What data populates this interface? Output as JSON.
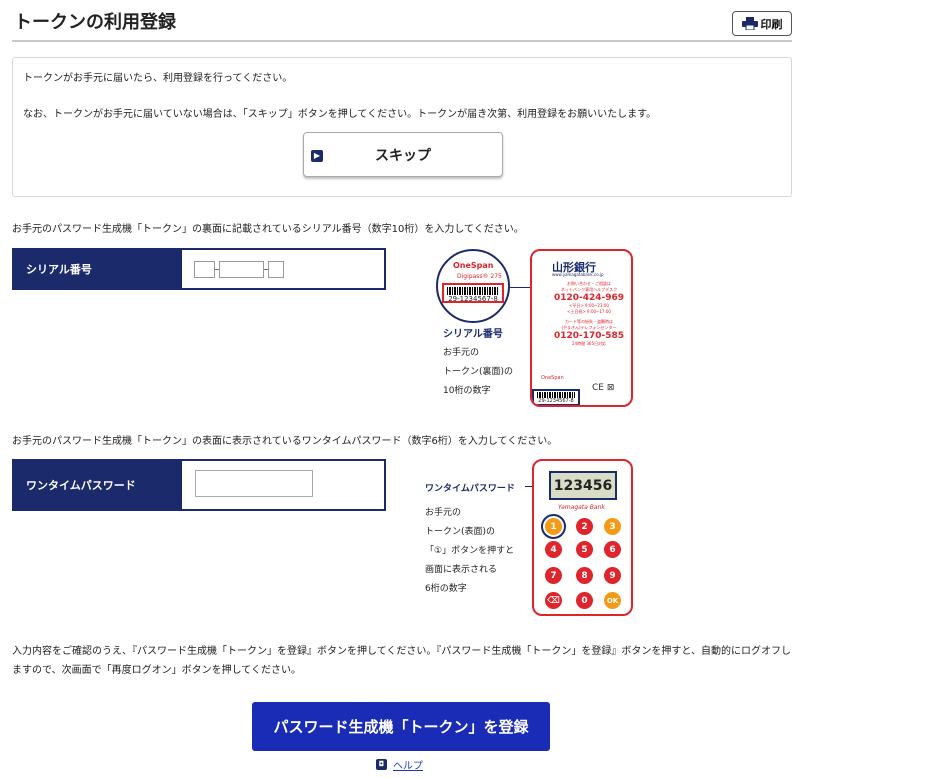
{
  "header": {
    "title": "トークンの利用登録",
    "print_label": "印刷"
  },
  "notice": {
    "line1": "トークンがお手元に届いたら、利用登録を行ってください。",
    "line2": "なお、トークンがお手元に届いていない場合は、「スキップ」ボタンを押してください。トークンが届き次第、利用登録をお願いいたします。",
    "skip_label": "スキップ"
  },
  "serial": {
    "instruction": "お手元のパスワード生成機「トークン」の裏面に記載されているシリアル番号（数字10桁）を入力してください。",
    "label": "シリアル番号",
    "fields": [
      "",
      "",
      ""
    ],
    "illustration": {
      "brand": "OneSpan",
      "model": "Digipass® 275",
      "serial_sample": "29-1234567-8",
      "caption_title": "シリアル番号",
      "caption_lines": [
        "お手元の",
        "トークン(裏面)の",
        "10桁の数字"
      ],
      "bank_name": "山形銀行",
      "bank_url": "www.yamagatabank.co.jp",
      "contact_1": "お問い合わせ・ご相談は",
      "contact_2": "ネットバンク専用ヘルプデスク",
      "phone_1": "0120-424-969",
      "hours_1": "<平日> 9:00~23:00",
      "hours_2": "<土日祝> 9:00~17:00",
      "contact_3": "カード等の紛失・盗難時は",
      "contact_4": "(やまぎん)テレフォンセンター",
      "phone_2": "0120-170-585",
      "hours_3": "24時間 365日対応"
    }
  },
  "otp": {
    "instruction": "お手元のパスワード生成機「トークン」の表面に表示されているワンタイムパスワード（数字6桁）を入力してください。",
    "label": "ワンタイムパスワード",
    "value": "",
    "illustration": {
      "caption_title": "ワンタイムパスワード",
      "caption_lines": [
        "お手元の",
        "トークン(表面)の",
        "「①」ボタンを押すと",
        "画面に表示される",
        "6桁の数字"
      ],
      "display_value": "123456",
      "bank_name": "Yamagata Bank",
      "keys": [
        "1",
        "2",
        "3",
        "4",
        "5",
        "6",
        "7",
        "8",
        "9",
        "⌫",
        "0",
        "OK"
      ]
    }
  },
  "final": {
    "instruction": "入力内容をご確認のうえ、『パスワード生成機「トークン」を登録』ボタンを押してください。『パスワード生成機「トークン」を登録』ボタンを押すと、自動的にログオフしますので、次画面で「再度ログオン」ボタンを押してください。",
    "register_label": "パスワード生成機「トークン」を登録",
    "help_label": "ヘルプ"
  },
  "colors": {
    "navy": "#1b2a6b",
    "button_blue": "#1a2bb5",
    "token_red": "#e0242b",
    "key_orange": "#f39a16"
  }
}
